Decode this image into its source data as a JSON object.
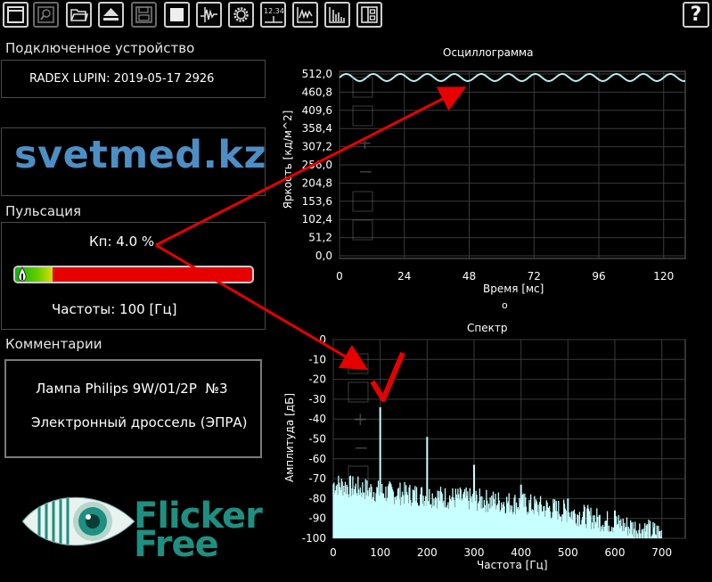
{
  "toolbar": {
    "buttons": [
      {
        "icon": "window-icon"
      },
      {
        "icon": "magnifier-icon"
      },
      {
        "icon": "folder-open-icon"
      },
      {
        "icon": "eject-icon"
      },
      {
        "icon": "floppy-save-icon"
      },
      {
        "icon": "stop-square-icon"
      },
      {
        "icon": "waveform-trigger-icon"
      },
      {
        "icon": "settings-gear-icon"
      },
      {
        "icon": "numeric-display-icon",
        "label": "12.34"
      },
      {
        "icon": "oscilloscope-icon"
      },
      {
        "icon": "spectrum-icon"
      },
      {
        "icon": "layout-panels-icon"
      },
      {
        "icon": "help-icon",
        "label": "?"
      }
    ]
  },
  "device": {
    "title": "Подключенное устройство",
    "name": "RADEX LUPIN: 2019-05-17 2926"
  },
  "brand": {
    "text": "svetmed.kz"
  },
  "pulsation": {
    "title": "Пульсация",
    "kp_label": "Кп: 4.0 %",
    "kp_value_percent": 4.0,
    "freq_label": "Частоты: 100 [Гц]"
  },
  "comments": {
    "title": "Комментарии",
    "line1": "Лампа Philips 9W/01/2P  №3",
    "line2": "Электронный дроссель (ЭПРА)"
  },
  "logo": {
    "word1": "Flicker",
    "word2": "Free"
  },
  "colors": {
    "accent_red": "#e60000",
    "trace": "#b8ecec",
    "spectrum_fill": "#c8ffff",
    "brand_blue": "#4d8fc4",
    "logo_teal": "#1e8f80"
  },
  "chart_data": [
    {
      "type": "line",
      "title": "Осциллограмма",
      "xlabel": "Время [мс]",
      "ylabel": "Яркость [кд/м^2]",
      "xlim": [
        0,
        128
      ],
      "ylim": [
        0,
        512
      ],
      "x_ticks": [
        "0",
        "24",
        "48",
        "72",
        "96",
        "120"
      ],
      "y_ticks": [
        "512,0",
        "460,8",
        "409,6",
        "358,4",
        "307,2",
        "256,0",
        "204,8",
        "153,6",
        "102,4",
        "51,2",
        "0,0"
      ],
      "grid": true,
      "series": [
        {
          "signal": "sine",
          "mean": 502,
          "amplitude": 10,
          "frequency_hz": 100,
          "x_range": [
            0,
            128
          ]
        }
      ]
    },
    {
      "type": "bar",
      "title": "Спектр",
      "xlabel": "Частота [Гц]",
      "ylabel": "Амплитуда [дБ]",
      "xlim": [
        0,
        750
      ],
      "ylim": [
        -100,
        0
      ],
      "x_ticks": [
        "0",
        "100",
        "200",
        "300",
        "400",
        "500",
        "600",
        "700"
      ],
      "y_ticks": [
        "0",
        "-10",
        "-20",
        "-30",
        "-40",
        "-50",
        "-60",
        "-70",
        "-80",
        "-90",
        "-100"
      ],
      "grid": true,
      "peaks": [
        {
          "x": 100,
          "y": -34
        },
        {
          "x": 200,
          "y": -49
        },
        {
          "x": 300,
          "y": -63
        },
        {
          "x": 400,
          "y": -73
        },
        {
          "x": 500,
          "y": -80
        },
        {
          "x": 600,
          "y": -86
        }
      ],
      "noise_floor": [
        {
          "x": 0,
          "y": -75
        },
        {
          "x": 100,
          "y": -79
        },
        {
          "x": 200,
          "y": -81
        },
        {
          "x": 300,
          "y": -83
        },
        {
          "x": 400,
          "y": -85
        },
        {
          "x": 500,
          "y": -89
        },
        {
          "x": 600,
          "y": -95
        },
        {
          "x": 700,
          "y": -100
        }
      ],
      "marker_label": "o"
    }
  ]
}
